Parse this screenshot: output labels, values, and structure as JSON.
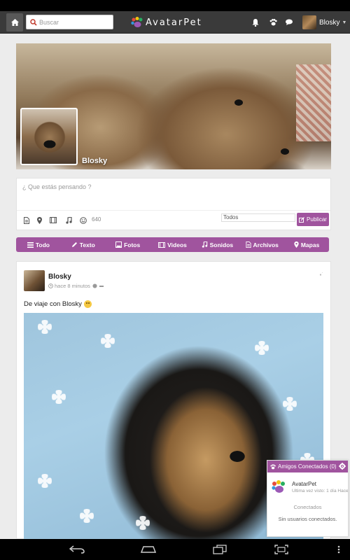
{
  "navbar": {
    "search_placeholder": "Buscar",
    "brand": "AvatarPet",
    "user_name": "Blosky"
  },
  "profile": {
    "name": "Blosky"
  },
  "composer": {
    "placeholder": "¿ Que estás pensando ?",
    "char_count": "640",
    "privacy": "Todos",
    "publish_label": "Publicar"
  },
  "filters": [
    {
      "label": "Todo",
      "icon": "list-icon"
    },
    {
      "label": "Texto",
      "icon": "pencil-icon"
    },
    {
      "label": "Fotos",
      "icon": "image-icon"
    },
    {
      "label": "Videos",
      "icon": "film-icon"
    },
    {
      "label": "Sonidos",
      "icon": "music-icon"
    },
    {
      "label": "Archivos",
      "icon": "file-icon"
    },
    {
      "label": "Mapas",
      "icon": "map-marker-icon"
    }
  ],
  "post": {
    "author": "Blosky",
    "time": "hace 8 minutos",
    "text": "De viaje con Blosky"
  },
  "friends_panel": {
    "title": "Amigos Conectados (0)",
    "friend_name": "AvatarPet",
    "friend_last_seen": "Ultima vez visto: 1 día Hace",
    "section_label": "Conectados",
    "empty_text": "Sin usuarios conectados."
  },
  "colors": {
    "accent": "#a0549e",
    "navbar": "#3a3a3a"
  }
}
